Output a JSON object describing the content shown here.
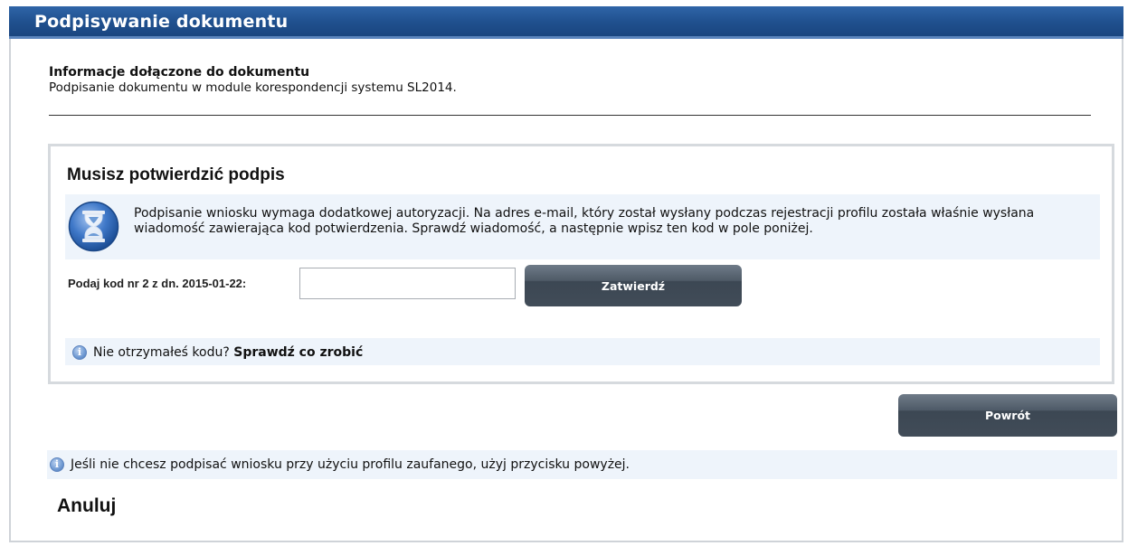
{
  "window": {
    "title": "Podpisywanie dokumentu"
  },
  "document_info": {
    "heading": "Informacje dołączone do dokumentu",
    "description": "Podpisanie dokumentu w module korespondencji systemu SL2014."
  },
  "confirm": {
    "title": "Musisz potwierdzić podpis",
    "message": "Podpisanie wniosku wymaga dodatkowej autoryzacji. Na adres e-mail, który został wysłany podczas rejestracji profilu została właśnie wysłana wiadomość zawierająca kod potwierdzenia. Sprawdź wiadomość, a następnie wpisz ten kod w pole poniżej.",
    "code_label": "Podaj kod nr 2 z dn. 2015-01-22:",
    "code_value": "",
    "submit_label": "Zatwierdź",
    "help_prefix": "Nie otrzymałeś kodu?",
    "help_link": "Sprawdź co zrobić"
  },
  "back_label": "Powrót",
  "bottom_info": "Jeśli nie chcesz podpisać wniosku przy użyciu profilu zaufanego, użyj przycisku powyżej.",
  "cancel_label": "Anuluj",
  "icons": {
    "hourglass": "hourglass-icon",
    "info": "info-icon"
  },
  "colors": {
    "titlebar": "#1f4f8d",
    "button": "#4e5a67",
    "band": "#eef4fb"
  }
}
